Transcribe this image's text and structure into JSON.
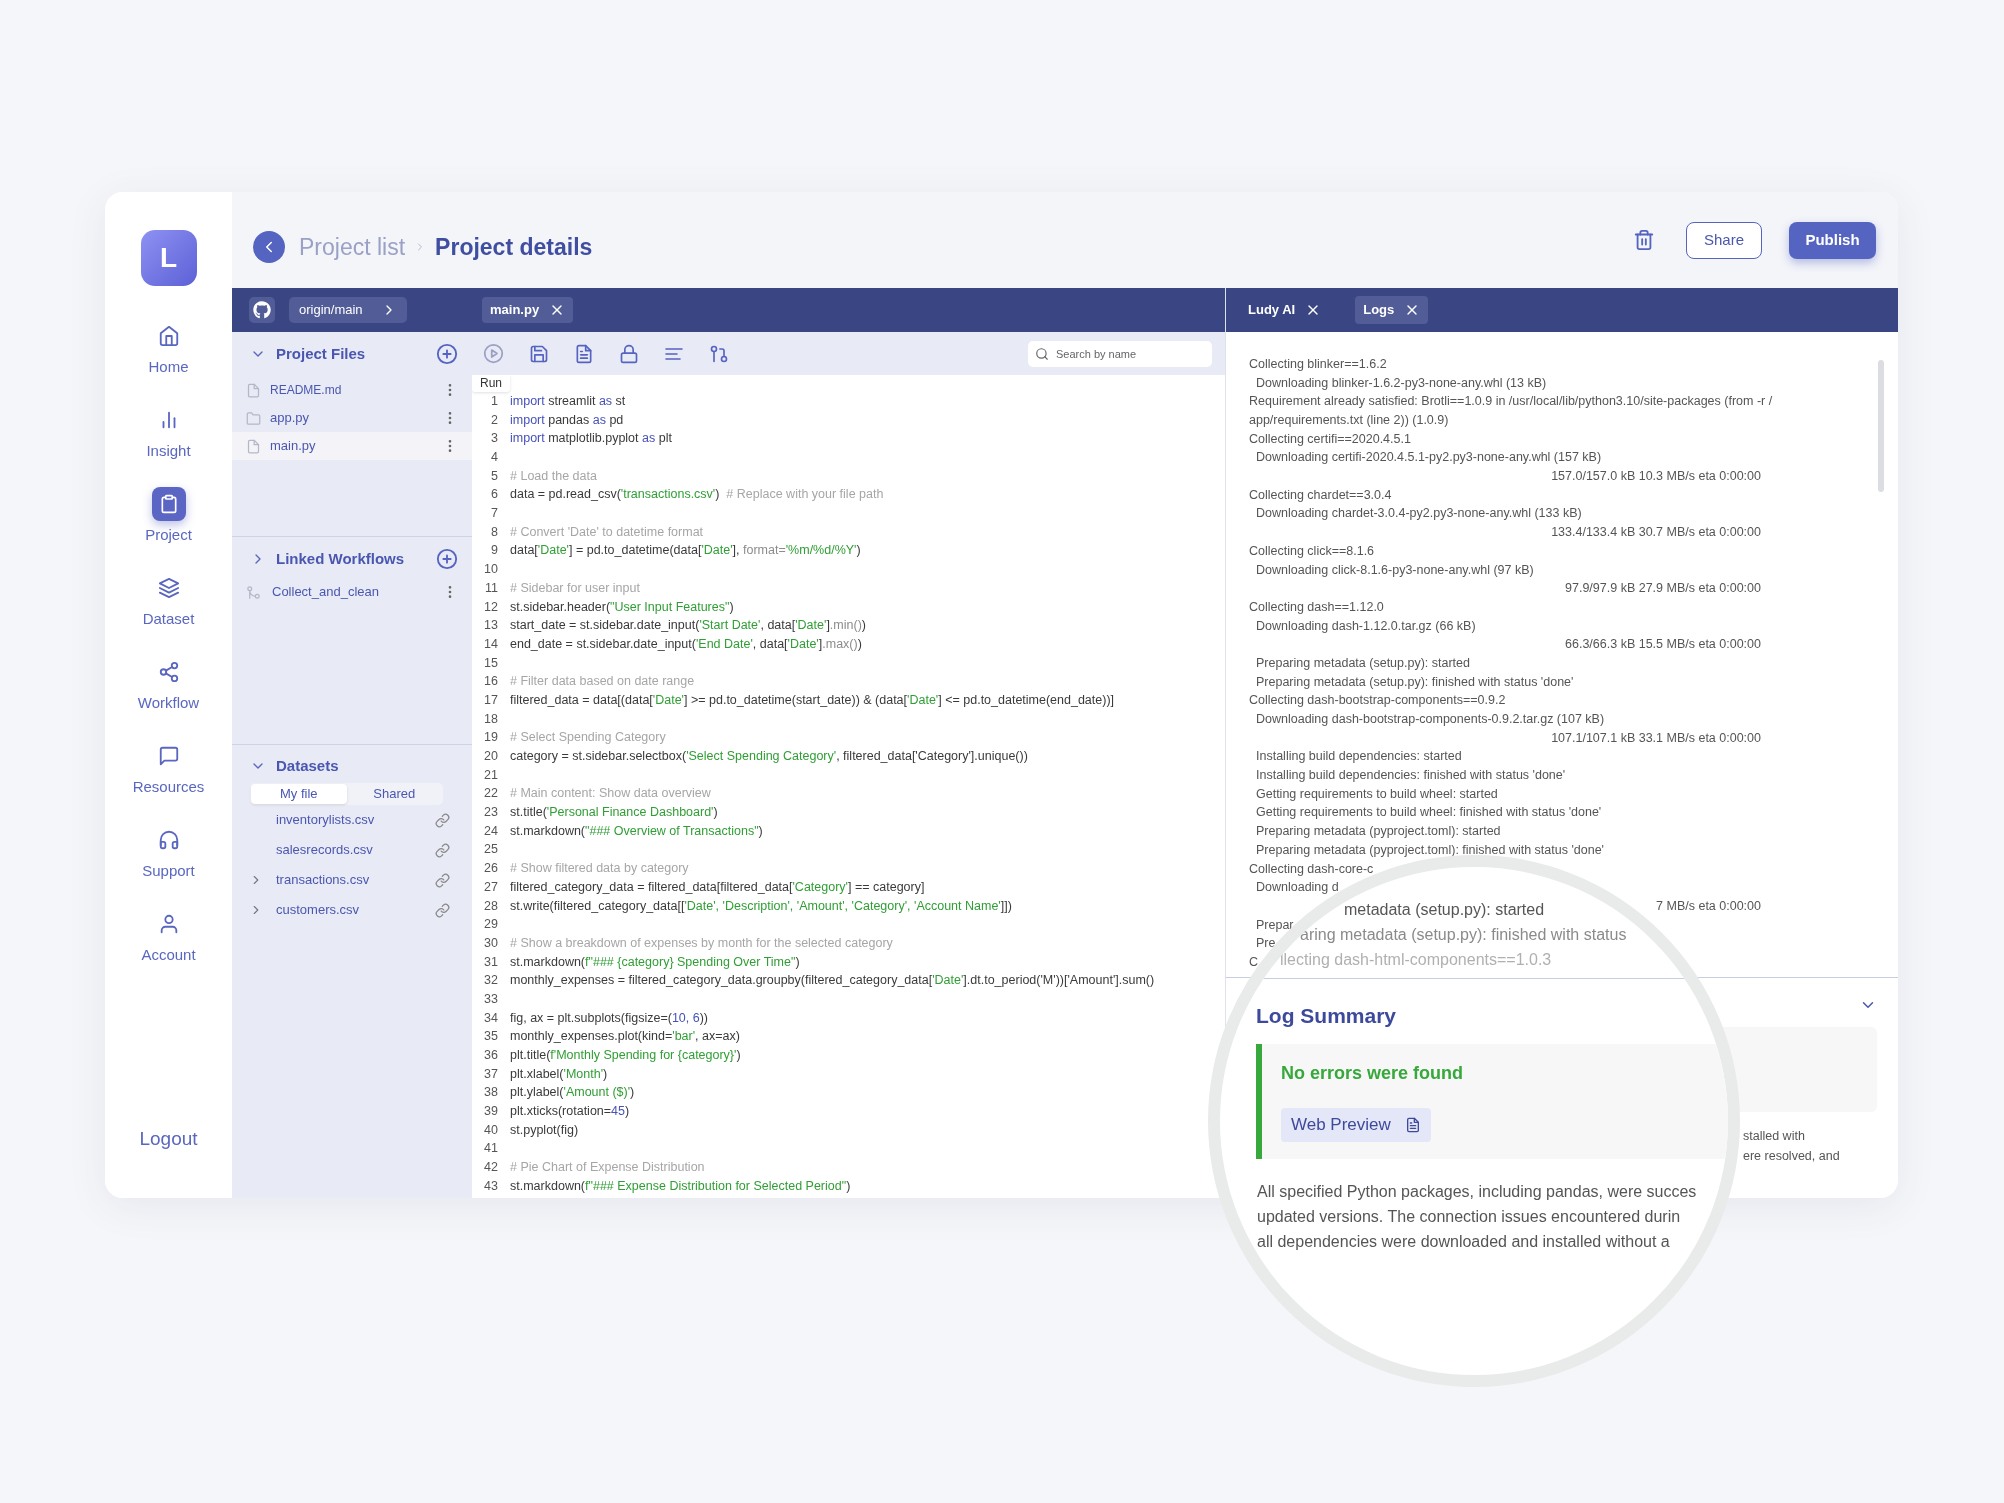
{
  "app": {
    "logo_letter": "L"
  },
  "nav": [
    {
      "label": "Home",
      "selected": false
    },
    {
      "label": "Insight",
      "selected": false
    },
    {
      "label": "Project",
      "selected": true
    },
    {
      "label": "Dataset",
      "selected": false
    },
    {
      "label": "Workflow",
      "selected": false
    },
    {
      "label": "Resources",
      "selected": false
    },
    {
      "label": "Support",
      "selected": false
    },
    {
      "label": "Account",
      "selected": false
    }
  ],
  "logout": "Logout",
  "breadcrumb": [
    {
      "label": "Project list",
      "selected": false
    },
    {
      "label": "Project details",
      "selected": true
    }
  ],
  "actions": {
    "share": "Share",
    "publish": "Publish"
  },
  "branch": "origin/main",
  "editor_tabs": [
    {
      "label": "main.py"
    }
  ],
  "panel_tabs": [
    {
      "label": "Ludy AI",
      "selected": false
    },
    {
      "label": "Logs",
      "selected": true
    }
  ],
  "project_files": {
    "title": "Project Files",
    "expanded": true,
    "items": [
      {
        "name": "README.md",
        "kind": "file",
        "selected": false
      },
      {
        "name": "app.py",
        "kind": "folder",
        "selected": false
      },
      {
        "name": "main.py",
        "kind": "file",
        "selected": true
      }
    ]
  },
  "linked_workflows": {
    "title": "Linked Workflows",
    "expanded": false,
    "items": [
      {
        "name": "Collect_and_clean"
      }
    ]
  },
  "datasets": {
    "title": "Datasets",
    "expanded": true,
    "tabs": [
      {
        "label": "My file",
        "selected": true
      },
      {
        "label": "Shared",
        "selected": false
      }
    ],
    "items": [
      {
        "name": "inventorylists.csv",
        "expandable": false
      },
      {
        "name": "salesrecords.csv",
        "expandable": false
      },
      {
        "name": "transactions.csv",
        "expandable": true
      },
      {
        "name": "customers.csv",
        "expandable": true
      }
    ]
  },
  "toolbar": {
    "tooltip": "Run"
  },
  "search": {
    "placeholder": "Search by name"
  },
  "code": [
    {
      "number": "1",
      "tokens": [
        {
          "kind": "kw",
          "text": "import"
        },
        {
          "kind": "plain",
          "text": " streamlit "
        },
        {
          "kind": "kw",
          "text": "as"
        },
        {
          "kind": "plain",
          "text": " st"
        }
      ]
    },
    {
      "number": "2",
      "tokens": [
        {
          "kind": "kw",
          "text": "import"
        },
        {
          "kind": "plain",
          "text": " pandas "
        },
        {
          "kind": "kw",
          "text": "as"
        },
        {
          "kind": "plain",
          "text": " pd"
        }
      ]
    },
    {
      "number": "3",
      "tokens": [
        {
          "kind": "kw",
          "text": "import"
        },
        {
          "kind": "plain",
          "text": " matplotlib.pyplot "
        },
        {
          "kind": "kw",
          "text": "as"
        },
        {
          "kind": "plain",
          "text": " plt"
        }
      ]
    },
    {
      "number": "4"
    },
    {
      "number": "5",
      "tokens": [
        {
          "kind": "comment",
          "text": "# Load the data"
        }
      ]
    },
    {
      "number": "6",
      "tokens": [
        {
          "kind": "plain",
          "text": "data = pd.read_csv("
        },
        {
          "kind": "str",
          "text": "'transactions.csv'"
        },
        {
          "kind": "plain",
          "text": ")  "
        },
        {
          "kind": "comment",
          "text": "# Replace with your file path"
        }
      ]
    },
    {
      "number": "7"
    },
    {
      "number": "8",
      "tokens": [
        {
          "kind": "comment",
          "text": "# Convert 'Date' to datetime format"
        }
      ]
    },
    {
      "number": "9",
      "tokens": [
        {
          "kind": "plain",
          "text": "data["
        },
        {
          "kind": "str",
          "text": "'Date'"
        },
        {
          "kind": "plain",
          "text": "] = pd.to_datetime(data["
        },
        {
          "kind": "str",
          "text": "'Date'"
        },
        {
          "kind": "plain",
          "text": "], "
        },
        {
          "kind": "muted",
          "text": "format="
        },
        {
          "kind": "str",
          "text": "'%m/%d/%Y'"
        },
        {
          "kind": "plain",
          "text": ")"
        }
      ]
    },
    {
      "number": "10"
    },
    {
      "number": "11",
      "tokens": [
        {
          "kind": "comment",
          "text": "# Sidebar for user input"
        }
      ]
    },
    {
      "number": "12",
      "tokens": [
        {
          "kind": "plain",
          "text": "st.sidebar.header("
        },
        {
          "kind": "str",
          "text": "\"User Input Features\""
        },
        {
          "kind": "plain",
          "text": ")"
        }
      ]
    },
    {
      "number": "13",
      "tokens": [
        {
          "kind": "plain",
          "text": "start_date = st.sidebar.date_input("
        },
        {
          "kind": "str",
          "text": "'Start Date'"
        },
        {
          "kind": "plain",
          "text": ", data["
        },
        {
          "kind": "str",
          "text": "'Date'"
        },
        {
          "kind": "plain",
          "text": "]"
        },
        {
          "kind": "muted",
          "text": ".min()"
        },
        {
          "kind": "plain",
          "text": ")"
        }
      ]
    },
    {
      "number": "14",
      "tokens": [
        {
          "kind": "plain",
          "text": "end_date = st.sidebar.date_input("
        },
        {
          "kind": "str",
          "text": "'End Date'"
        },
        {
          "kind": "plain",
          "text": ", data["
        },
        {
          "kind": "str",
          "text": "'Date'"
        },
        {
          "kind": "plain",
          "text": "]"
        },
        {
          "kind": "muted",
          "text": ".max()"
        },
        {
          "kind": "plain",
          "text": ")"
        }
      ]
    },
    {
      "number": "15"
    },
    {
      "number": "16",
      "tokens": [
        {
          "kind": "comment",
          "text": "# Filter data based on date range"
        }
      ]
    },
    {
      "number": "17",
      "tokens": [
        {
          "kind": "plain",
          "text": "filtered_data = data[(data["
        },
        {
          "kind": "str",
          "text": "'Date'"
        },
        {
          "kind": "plain",
          "text": "] >= pd.to_datetime(start_date)) & (data["
        },
        {
          "kind": "str",
          "text": "'Date'"
        },
        {
          "kind": "plain",
          "text": "] <= pd.to_datetime(end_date))]"
        }
      ]
    },
    {
      "number": "18"
    },
    {
      "number": "19",
      "tokens": [
        {
          "kind": "comment",
          "text": "# Select Spending Category"
        }
      ]
    },
    {
      "number": "20",
      "tokens": [
        {
          "kind": "plain",
          "text": "category = st.sidebar.selectbox("
        },
        {
          "kind": "str",
          "text": "'Select Spending Category'"
        },
        {
          "kind": "plain",
          "text": ", filtered_data['Category'].unique())"
        }
      ]
    },
    {
      "number": "21"
    },
    {
      "number": "22",
      "tokens": [
        {
          "kind": "comment",
          "text": "# Main content: Show data overview"
        }
      ]
    },
    {
      "number": "23",
      "tokens": [
        {
          "kind": "plain",
          "text": "st.title("
        },
        {
          "kind": "str",
          "text": "'Personal Finance Dashboard'"
        },
        {
          "kind": "plain",
          "text": ")"
        }
      ]
    },
    {
      "number": "24",
      "tokens": [
        {
          "kind": "plain",
          "text": "st.markdown("
        },
        {
          "kind": "str",
          "text": "\"### Overview of Transactions\""
        },
        {
          "kind": "plain",
          "text": ")"
        }
      ]
    },
    {
      "number": "25"
    },
    {
      "number": "26",
      "tokens": [
        {
          "kind": "comment",
          "text": "# Show filtered data by category"
        }
      ]
    },
    {
      "number": "27",
      "tokens": [
        {
          "kind": "plain",
          "text": "filtered_category_data = filtered_data[filtered_data["
        },
        {
          "kind": "str",
          "text": "'Category'"
        },
        {
          "kind": "plain",
          "text": "] == category]"
        }
      ]
    },
    {
      "number": "28",
      "tokens": [
        {
          "kind": "plain",
          "text": "st.write(filtered_category_data[["
        },
        {
          "kind": "str",
          "text": "'Date', 'Description', 'Amount', 'Category', 'Account Name'"
        },
        {
          "kind": "plain",
          "text": "]])"
        }
      ]
    },
    {
      "number": "29"
    },
    {
      "number": "30",
      "tokens": [
        {
          "kind": "comment",
          "text": "# Show a breakdown of expenses by month for the selected category"
        }
      ]
    },
    {
      "number": "31",
      "tokens": [
        {
          "kind": "plain",
          "text": "st.markdown("
        },
        {
          "kind": "str",
          "text": "f\"### {category} Spending Over Time\""
        },
        {
          "kind": "plain",
          "text": ")"
        }
      ]
    },
    {
      "number": "32",
      "tokens": [
        {
          "kind": "plain",
          "text": "monthly_expenses = filtered_category_data.groupby(filtered_category_data["
        },
        {
          "kind": "str",
          "text": "'Date'"
        },
        {
          "kind": "plain",
          "text": "].dt.to_period('M'))['Amount'].sum()"
        }
      ]
    },
    {
      "number": "33"
    },
    {
      "number": "34",
      "tokens": [
        {
          "kind": "plain",
          "text": "fig, ax = plt.subplots(figsize=("
        },
        {
          "kind": "num",
          "text": "10, 6"
        },
        {
          "kind": "plain",
          "text": "))"
        }
      ]
    },
    {
      "number": "35",
      "tokens": [
        {
          "kind": "plain",
          "text": "monthly_expenses.plot(kind="
        },
        {
          "kind": "str",
          "text": "'bar'"
        },
        {
          "kind": "plain",
          "text": ", ax=ax)"
        }
      ]
    },
    {
      "number": "36",
      "tokens": [
        {
          "kind": "plain",
          "text": "plt.title("
        },
        {
          "kind": "str",
          "text": "f'Monthly Spending for {category}'"
        },
        {
          "kind": "plain",
          "text": ")"
        }
      ]
    },
    {
      "number": "37",
      "tokens": [
        {
          "kind": "plain",
          "text": "plt.xlabel("
        },
        {
          "kind": "str",
          "text": "'Month'"
        },
        {
          "kind": "plain",
          "text": ")"
        }
      ]
    },
    {
      "number": "38",
      "tokens": [
        {
          "kind": "plain",
          "text": "plt.ylabel("
        },
        {
          "kind": "str",
          "text": "'Amount ($)'"
        },
        {
          "kind": "plain",
          "text": ")"
        }
      ]
    },
    {
      "number": "39",
      "tokens": [
        {
          "kind": "plain",
          "text": "plt.xticks(rotation="
        },
        {
          "kind": "num",
          "text": "45"
        },
        {
          "kind": "plain",
          "text": ")"
        }
      ]
    },
    {
      "number": "40",
      "tokens": [
        {
          "kind": "plain",
          "text": "st.pyplot(fig)"
        }
      ]
    },
    {
      "number": "41"
    },
    {
      "number": "42",
      "tokens": [
        {
          "kind": "comment",
          "text": "# Pie Chart of Expense Distribution"
        }
      ]
    },
    {
      "number": "43",
      "tokens": [
        {
          "kind": "plain",
          "text": "st.markdown("
        },
        {
          "kind": "str",
          "text": "f\"### Expense Distribution for Selected Period\""
        },
        {
          "kind": "plain",
          "text": ")"
        }
      ]
    }
  ],
  "logs": [
    {
      "kind": "head",
      "text": "Collecting blinker==1.6.2"
    },
    {
      "kind": "sub",
      "text": "Downloading blinker-1.6.2-py3-none-any.whl (13 kB)"
    },
    {
      "kind": "head",
      "text": "Requirement already satisfied: Brotli==1.0.9 in /usr/local/lib/python3.10/site-packages (from -r /"
    },
    {
      "kind": "head",
      "text": "app/requirements.txt (line 2)) (1.0.9)"
    },
    {
      "kind": "head",
      "text": "Collecting certifi==2020.4.5.1"
    },
    {
      "kind": "sub",
      "text": "Downloading certifi-2020.4.5.1-py2.py3-none-any.whl (157 kB)"
    },
    {
      "kind": "progress",
      "text": "157.0/157.0 kB 10.3 MB/s eta 0:00:00"
    },
    {
      "kind": "head",
      "text": "Collecting chardet==3.0.4"
    },
    {
      "kind": "sub",
      "text": "Downloading chardet-3.0.4-py2.py3-none-any.whl (133 kB)"
    },
    {
      "kind": "progress",
      "text": "133.4/133.4 kB 30.7 MB/s eta 0:00:00"
    },
    {
      "kind": "head",
      "text": "Collecting click==8.1.6"
    },
    {
      "kind": "sub",
      "text": "Downloading click-8.1.6-py3-none-any.whl (97 kB)"
    },
    {
      "kind": "progress",
      "text": "97.9/97.9 kB 27.9 MB/s eta 0:00:00"
    },
    {
      "kind": "head",
      "text": "Collecting dash==1.12.0"
    },
    {
      "kind": "sub",
      "text": "Downloading dash-1.12.0.tar.gz (66 kB)"
    },
    {
      "kind": "progress",
      "text": "66.3/66.3 kB 15.5 MB/s eta 0:00:00"
    },
    {
      "kind": "sub",
      "text": "Preparing metadata (setup.py): started"
    },
    {
      "kind": "sub",
      "text": "Preparing metadata (setup.py): finished with status 'done'"
    },
    {
      "kind": "head",
      "text": "Collecting dash-bootstrap-components==0.9.2"
    },
    {
      "kind": "sub",
      "text": "Downloading dash-bootstrap-components-0.9.2.tar.gz (107 kB)"
    },
    {
      "kind": "progress",
      "text": "107.1/107.1 kB 33.1 MB/s eta 0:00:00"
    },
    {
      "kind": "sub",
      "text": "Installing build dependencies: started"
    },
    {
      "kind": "sub",
      "text": "Installing build dependencies: finished with status 'done'"
    },
    {
      "kind": "sub",
      "text": "Getting requirements to build wheel: started"
    },
    {
      "kind": "sub",
      "text": "Getting requirements to build wheel: finished with status 'done'"
    },
    {
      "kind": "sub",
      "text": "Preparing metadata (pyproject.toml): started"
    },
    {
      "kind": "sub",
      "text": "Preparing metadata (pyproject.toml): finished with status 'done'"
    },
    {
      "kind": "head",
      "text": "Collecting dash-core-c"
    },
    {
      "kind": "sub",
      "text": "Downloading d"
    },
    {
      "kind": "progress",
      "text": "7 MB/s eta 0:00:00"
    },
    {
      "kind": "sub",
      "text": "Prepar"
    },
    {
      "kind": "sub",
      "text": "Pre"
    },
    {
      "kind": "head",
      "text": "C"
    }
  ],
  "log_summary": {
    "expanded": true,
    "visible_text": [
      "stalled with",
      "ere resolved, and"
    ]
  },
  "magnifier": {
    "log_lines": [
      "metadata (setup.py): started",
      "aring metadata (setup.py): finished with status",
      "llecting dash-html-components==1.0.3"
    ],
    "title": "Log Summary",
    "status": "No errors were found",
    "preview_button": "Web Preview",
    "paragraph": [
      "All specified Python packages, including pandas, were succes",
      "updated versions. The connection issues encountered durin",
      "all dependencies were downloaded and installed without a"
    ]
  }
}
